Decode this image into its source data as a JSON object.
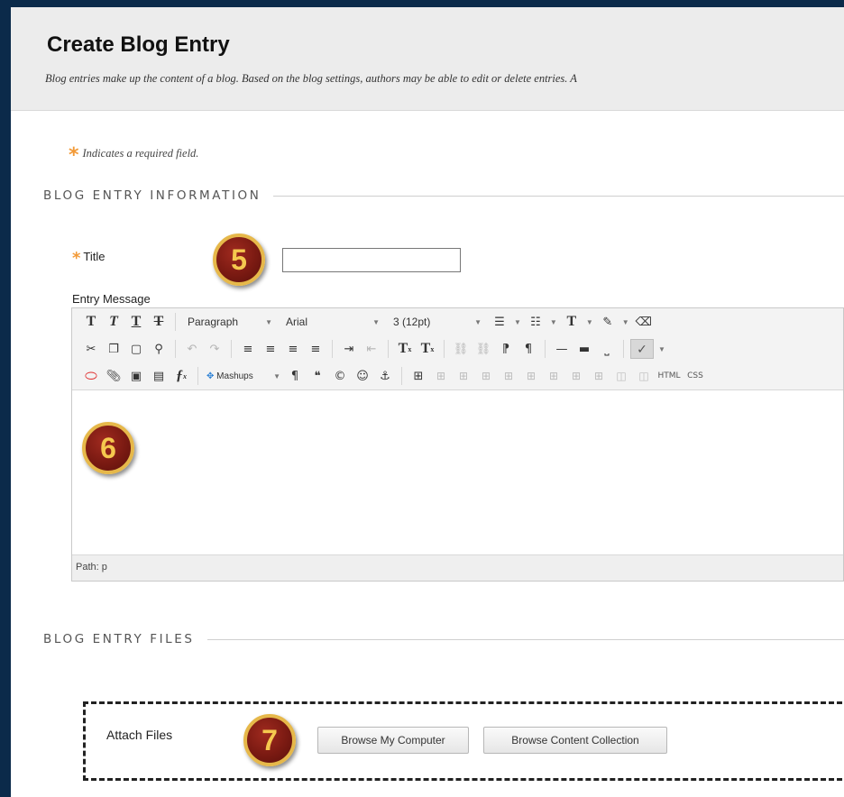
{
  "header": {
    "title": "Create Blog Entry",
    "description": "Blog entries make up the content of a blog. Based on the blog settings, authors may be able to edit or delete entries. A"
  },
  "required_note": {
    "star": "*",
    "text": "Indicates a required field."
  },
  "sections": {
    "info": "BLOG ENTRY INFORMATION",
    "files": "BLOG ENTRY FILES"
  },
  "form": {
    "title_label": "Title",
    "title_value": "",
    "entry_label": "Entry Message"
  },
  "editor": {
    "format_dropdown": "Paragraph",
    "font_dropdown": "Arial",
    "size_dropdown": "3 (12pt)",
    "mashups_label": "Mashups",
    "html_label": "HTML",
    "css_label": "CSS",
    "path_label": "Path: p"
  },
  "files": {
    "attach_label": "Attach Files",
    "browse_computer": "Browse My Computer",
    "browse_collection": "Browse Content Collection"
  },
  "callouts": {
    "five": "5",
    "six": "6",
    "seven": "7"
  },
  "colors": {
    "required_star": "#f29a38",
    "callout_fill": "#7a1a12",
    "callout_ring": "#e6b84a",
    "outer_frame": "#0b2a4a"
  }
}
